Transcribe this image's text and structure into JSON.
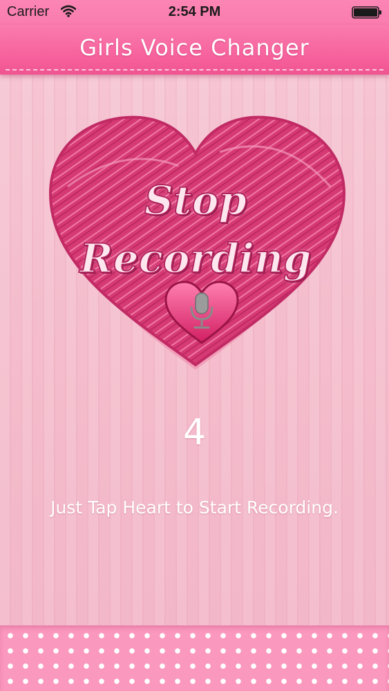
{
  "status_bar": {
    "carrier": "Carrier",
    "time": "2:54 PM",
    "wifi_icon": "wifi-icon",
    "battery_icon": "battery-icon"
  },
  "header": {
    "title": "Girls Voice Changer"
  },
  "heart_button": {
    "line1": "Stop",
    "line2": "Recording",
    "icon": "microphone-icon"
  },
  "counter": "4",
  "instruction": "Just Tap Heart to Start Recording.",
  "colors": {
    "accent": "#f65f9b",
    "heart": "#d8346f",
    "background": "#f4bccc"
  }
}
